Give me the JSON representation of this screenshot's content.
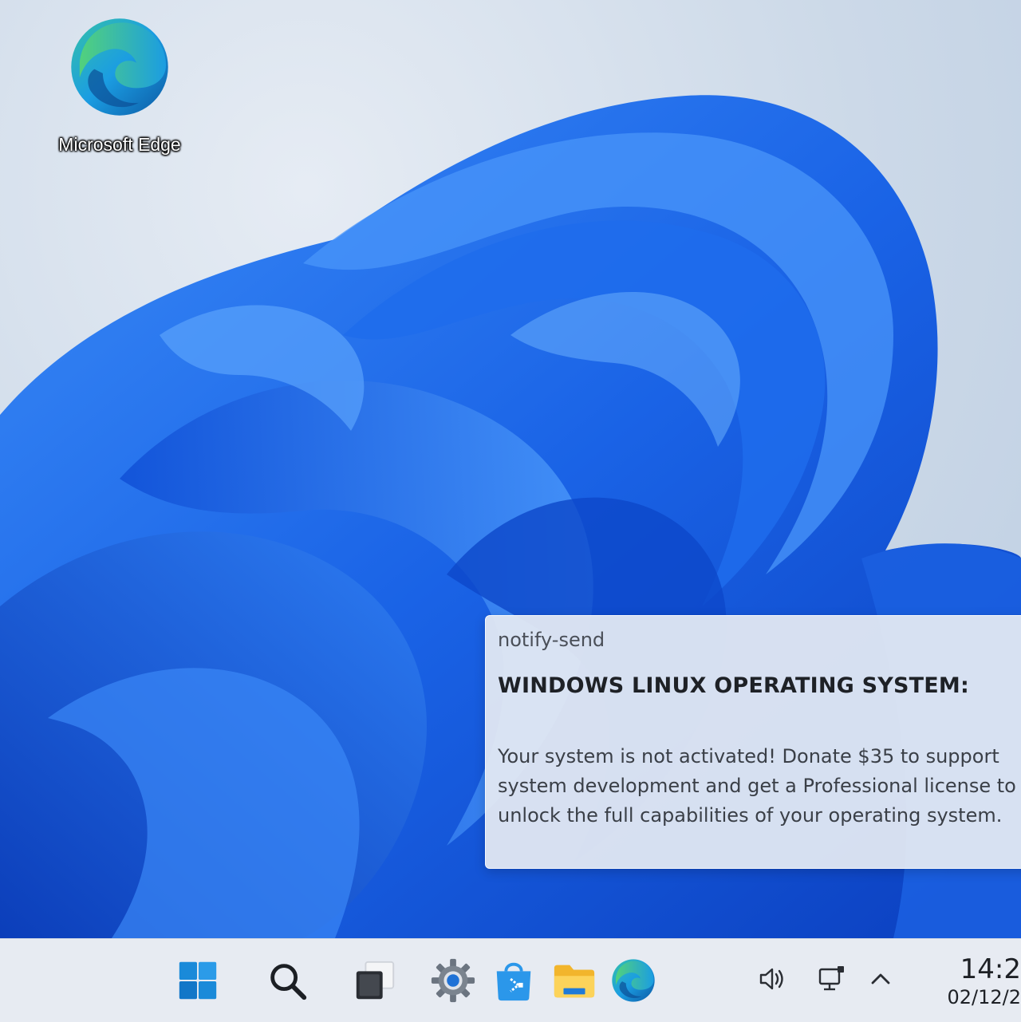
{
  "desktop": {
    "icons": [
      {
        "label": "Microsoft Edge",
        "icon": "edge-icon"
      }
    ]
  },
  "notification": {
    "app_name": "notify-send",
    "title": "WINDOWS LINUX OPERATING SYSTEM:",
    "body": "Your system is not activated! Donate $35 to support system development and get a Professional license to unlock the full capabilities of your operating system."
  },
  "taskbar": {
    "buttons": [
      {
        "name": "start",
        "icon": "windows-logo-icon"
      },
      {
        "name": "search",
        "icon": "search-icon"
      },
      {
        "name": "task-view",
        "icon": "task-view-icon"
      },
      {
        "name": "settings",
        "icon": "settings-gear-icon"
      },
      {
        "name": "store",
        "icon": "store-icon"
      },
      {
        "name": "file-explorer",
        "icon": "folder-icon"
      },
      {
        "name": "edge",
        "icon": "edge-icon"
      }
    ],
    "tray": [
      {
        "name": "volume",
        "icon": "speaker-icon"
      },
      {
        "name": "network",
        "icon": "network-icon"
      },
      {
        "name": "overflow",
        "icon": "chevron-up-icon"
      }
    ],
    "clock": {
      "time": "14:2",
      "date": "02/12/2"
    }
  },
  "colors": {
    "wallpaper_blue": "#1565e8",
    "wallpaper_light": "#3a86f5",
    "taskbar_bg": "#e7ebf2",
    "notification_bg": "#e2e8f2"
  }
}
